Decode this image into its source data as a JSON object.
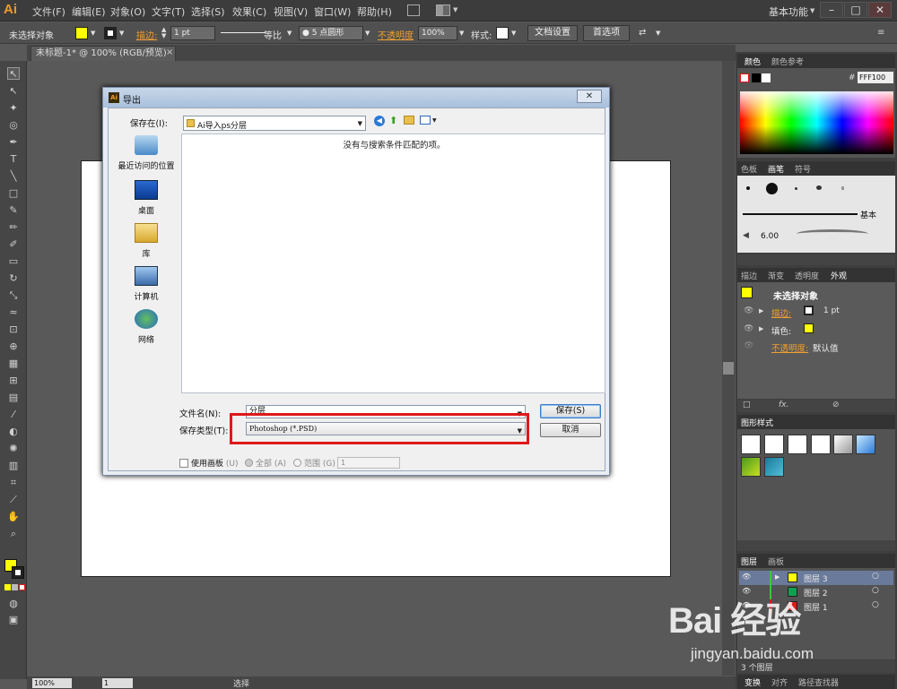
{
  "app": {
    "logo": "Ai"
  },
  "menu": [
    "文件(F)",
    "编辑(E)",
    "对象(O)",
    "文字(T)",
    "选择(S)",
    "效果(C)",
    "视图(V)",
    "窗口(W)",
    "帮助(H)"
  ],
  "workspace": "基本功能",
  "window_buttons": {
    "minimize": "–",
    "maximize": "□",
    "close": "✕"
  },
  "control_bar": {
    "selection": "未选择对象",
    "stroke_label": "描边:",
    "stroke_weight": "1 pt",
    "stroke_profile": "等比",
    "brush": "5 点圆形",
    "opacity_label": "不透明度",
    "opacity_value": "100%",
    "style_label": "样式:",
    "doc_setup": "文档设置",
    "preferences": "首选项",
    "colors": {
      "fill": "#ffff00",
      "accent": "#f0a030"
    }
  },
  "document_tab": {
    "title": "未标题-1* @ 100% (RGB/预览)",
    "close": "×"
  },
  "status_bar": {
    "zoom": "100%",
    "artboard": "1",
    "tool": "选择"
  },
  "panels": {
    "color": {
      "tabs": [
        "颜色",
        "颜色参考"
      ],
      "hex_prefix": "#",
      "hex": "FFF100"
    },
    "brush": {
      "tabs": [
        "色板",
        "画笔",
        "符号"
      ],
      "basic_label": "基本",
      "size": "6.00"
    },
    "appearance": {
      "tabs": [
        "描边",
        "渐变",
        "透明度",
        "外观"
      ],
      "title": "未选择对象",
      "stroke_label": "描边:",
      "stroke_value": "1 pt",
      "fill_label": "填色:",
      "opacity_label": "不透明度:",
      "opacity_value": "默认值",
      "fx_label": "fx."
    },
    "graphic_styles": {
      "tabs": [
        "图形样式"
      ]
    },
    "layers": {
      "tabs": [
        "图层",
        "画板"
      ],
      "rows": [
        {
          "name": "图层 3",
          "color": "#ffff00",
          "bar": "#3ac83a"
        },
        {
          "name": "图层 2",
          "color": "#10a050",
          "bar": "#3ac83a"
        },
        {
          "name": "图层 1",
          "color": "#e01818",
          "bar": "#e01818"
        }
      ],
      "count": "3 个图层"
    },
    "bottom": {
      "tabs": [
        "变换",
        "对齐",
        "路径查找器"
      ]
    }
  },
  "dialog": {
    "title": "导出",
    "close": "✕",
    "save_in_label": "保存在(I):",
    "save_in_value": "Ai导入ps分层",
    "places": [
      {
        "label": "最近访问的位置",
        "icon": "recent-places-icon"
      },
      {
        "label": "桌面",
        "icon": "desktop-icon"
      },
      {
        "label": "库",
        "icon": "libraries-icon"
      },
      {
        "label": "计算机",
        "icon": "computer-icon"
      },
      {
        "label": "网络",
        "icon": "network-icon"
      }
    ],
    "empty_message": "没有与搜索条件匹配的项。",
    "filename_label": "文件名(N):",
    "filename_value": "分层",
    "filetype_label": "保存类型(T):",
    "filetype_value": "Photoshop (*.PSD)",
    "save_button": "保存(S)",
    "cancel_button": "取消",
    "use_artboards_label": "使用画板",
    "use_artboards_key": "(U)",
    "all_label": "全部",
    "all_key": "(A)",
    "range_label": "范围",
    "range_key": "(G)",
    "range_value": "1"
  },
  "watermark": {
    "logo": "Bai 经验",
    "url": "jingyan.baidu.com"
  }
}
